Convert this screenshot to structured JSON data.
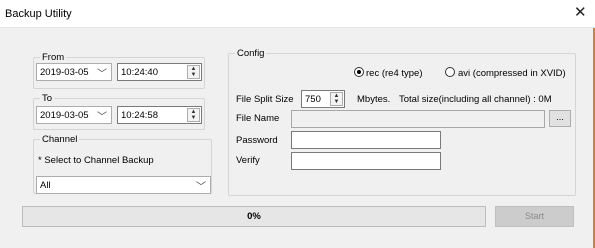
{
  "window": {
    "title": "Backup Utility",
    "close_icon": "close-icon"
  },
  "from": {
    "legend": "From",
    "date": "2019-03-05",
    "time": "10:24:40"
  },
  "to": {
    "legend": "To",
    "date": "2019-03-05",
    "time": "10:24:58"
  },
  "channel": {
    "legend": "Channel",
    "hint": "* Select to Channel Backup",
    "selected": "All"
  },
  "config": {
    "legend": "Config",
    "format_options": [
      {
        "label": "rec (re4 type)",
        "selected": true
      },
      {
        "label": "avi (compressed in XVID)",
        "selected": false
      }
    ],
    "split_label": "File Split Size",
    "split_value": "750",
    "split_unit": "Mbytes.",
    "total_size": "Total size(including all channel) : 0M",
    "filename_label": "File Name",
    "filename_value": "",
    "browse_label": "...",
    "password_label": "Password",
    "password_value": "",
    "verify_label": "Verify",
    "verify_value": ""
  },
  "progress": {
    "percent": 0,
    "label": "0%"
  },
  "start_button": {
    "label": "Start",
    "enabled": false
  },
  "icons": {
    "dropdown": "chevron-down-icon",
    "spin_up": "spin-up-icon",
    "spin_down": "spin-down-icon"
  }
}
